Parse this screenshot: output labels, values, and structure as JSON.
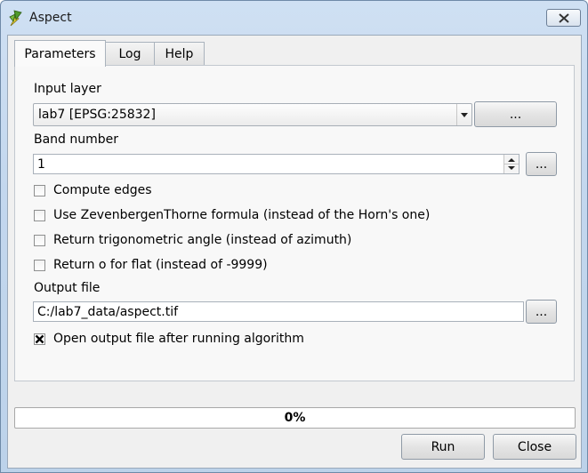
{
  "window": {
    "title": "Aspect"
  },
  "tabs": [
    {
      "label": "Parameters",
      "active": true
    },
    {
      "label": "Log",
      "active": false
    },
    {
      "label": "Help",
      "active": false
    }
  ],
  "form": {
    "input_layer": {
      "label": "Input layer",
      "value": "lab7 [EPSG:25832]",
      "browse_label": "..."
    },
    "band_number": {
      "label": "Band number",
      "value": "1",
      "browse_label": "..."
    },
    "checkboxes": [
      {
        "label": "Compute edges",
        "checked": false
      },
      {
        "label": "Use ZevenbergenThorne formula (instead of the Horn's one)",
        "checked": false
      },
      {
        "label": "Return trigonometric angle (instead of azimuth)",
        "checked": false
      },
      {
        "label": "Return o for flat (instead of -9999)",
        "checked": false
      }
    ],
    "output_file": {
      "label": "Output file",
      "value": "C:/lab7_data/aspect.tif",
      "browse_label": "..."
    },
    "open_output": {
      "label": "Open output file after running algorithm",
      "checked": true
    }
  },
  "progress": {
    "value": 0,
    "text": "0%"
  },
  "buttons": {
    "run": "Run",
    "close": "Close"
  },
  "colors": {
    "progress_fill": "#3fb24a",
    "icon_green": "#4f9a2c",
    "icon_yellow": "#e8d23a"
  },
  "icons": {
    "app": "qgis-logo-icon",
    "close": "close-icon"
  }
}
